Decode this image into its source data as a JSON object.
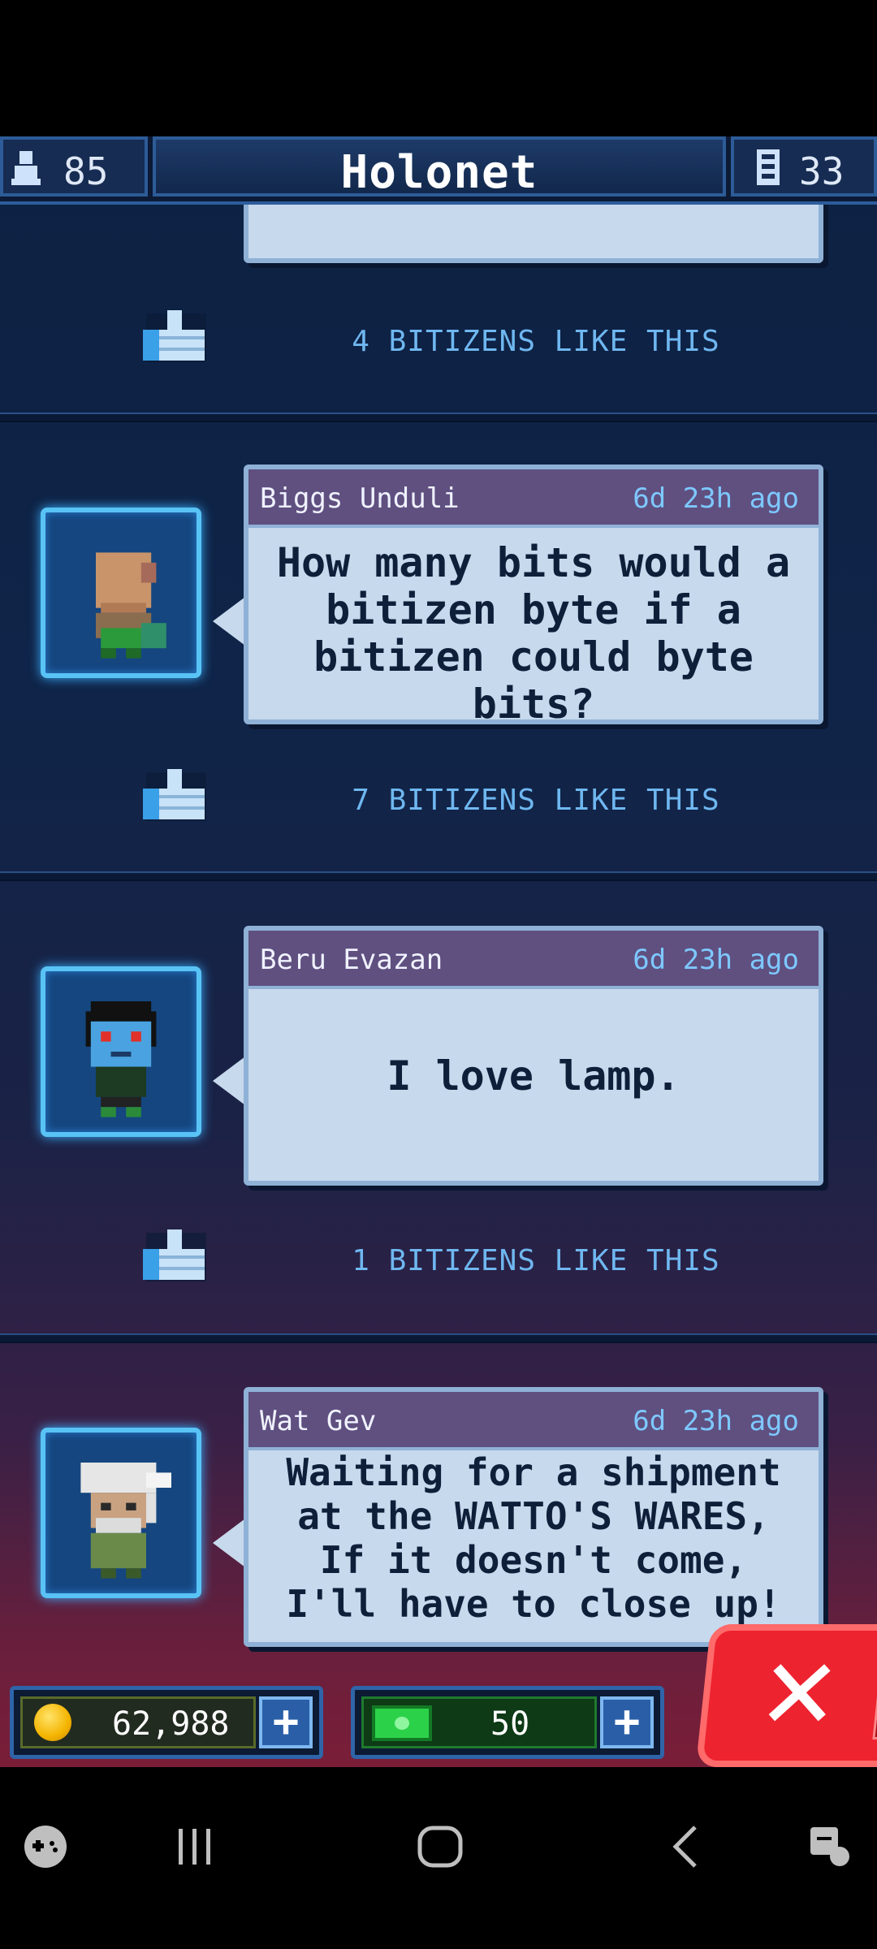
{
  "header": {
    "population": "85",
    "title": "Holonet",
    "floors": "33"
  },
  "posts": [
    {
      "author": "",
      "time": "",
      "message": "",
      "likes": "4 BITIZENS LIKE THIS"
    },
    {
      "author": "Biggs Unduli",
      "time": "6d 23h ago",
      "message": "How many bits would a bitizen byte if a bitizen could byte bits?",
      "likes": "7 BITIZENS LIKE THIS"
    },
    {
      "author": "Beru Evazan",
      "time": "6d 23h ago",
      "message": "I love lamp.",
      "likes": "1 BITIZENS LIKE THIS"
    },
    {
      "author": "Wat Gev",
      "time": "6d 23h ago",
      "message": "Waiting for a shipment at the WATTO'S WARES, If it doesn't come, I'll have to close up!",
      "likes": ""
    }
  ],
  "currency": {
    "coins": "62,988",
    "bux": "50"
  },
  "icons": {
    "population": "person-icon",
    "floors": "floor-icon",
    "like": "thumbs-up-icon",
    "coins": "coin-icon",
    "bux": "bux-icon",
    "add": "plus-icon",
    "close": "close-icon",
    "nav_game": "game-launcher-icon",
    "nav_recents": "recents-icon",
    "nav_home": "home-icon",
    "nav_back": "back-icon",
    "nav_assist": "assistant-icon"
  },
  "colors": {
    "accent_frame": "#59c3f6",
    "bubble": "#c7d9ec",
    "likes_text": "#6fb7f0",
    "close_button": "#ee2330"
  }
}
